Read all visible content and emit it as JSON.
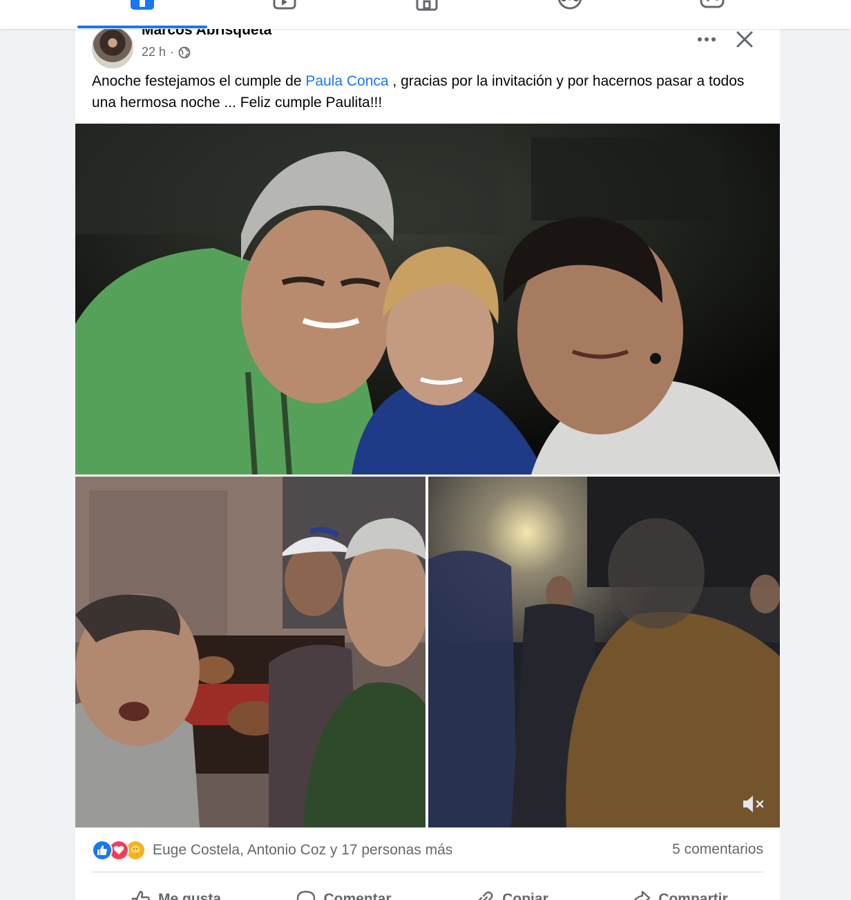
{
  "nav": {
    "tabs": [
      {
        "icon": "home-icon",
        "active": true
      },
      {
        "icon": "video-icon",
        "active": false
      },
      {
        "icon": "marketplace-icon",
        "active": false
      },
      {
        "icon": "groups-icon",
        "active": false
      },
      {
        "icon": "gaming-icon",
        "active": false
      }
    ],
    "accent": "#1877f2"
  },
  "post": {
    "author": "Marcos Abrisqueta",
    "time": "22 h",
    "separator": "·",
    "audience_icon": "globe-icon",
    "text_before": "Anoche festejamos el cumple de ",
    "tagged_person": "Paula Conca",
    "text_after": " , gracias por la invitación y por hacernos pasar a todos una hermosa noche ... Feliz cumple Paulita!!!",
    "photos": [
      {
        "name": "photo-selfie-three-people"
      },
      {
        "name": "photo-grill-selfie"
      },
      {
        "name": "video-party-crowd",
        "muted_icon": "mute-icon"
      }
    ],
    "reactions": {
      "icons": [
        "like-icon",
        "love-icon",
        "care-icon"
      ],
      "names": "Euge Costela, Antonio Coz y 17 personas más",
      "comments": "5 comentarios"
    },
    "actions": {
      "like": "Me gusta",
      "comment": "Comentar",
      "copy": "Copiar",
      "share": "Compartir"
    }
  }
}
